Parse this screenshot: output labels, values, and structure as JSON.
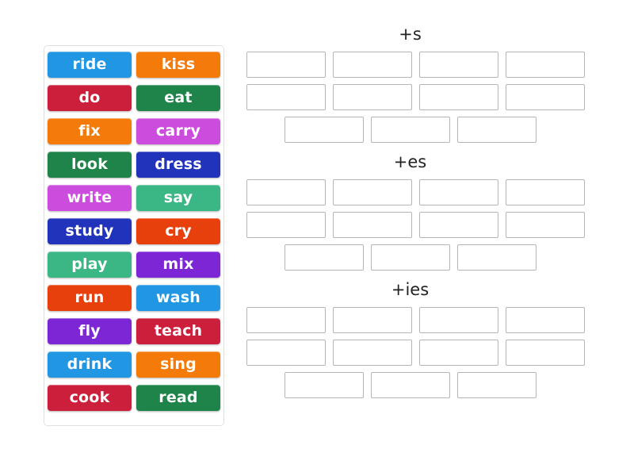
{
  "word_bank": {
    "name": "word-bank",
    "tiles": [
      {
        "label": "ride",
        "color": "#2196e3"
      },
      {
        "label": "kiss",
        "color": "#f47b0a"
      },
      {
        "label": "do",
        "color": "#cc1f3c"
      },
      {
        "label": "eat",
        "color": "#1e8449"
      },
      {
        "label": "fix",
        "color": "#f47b0a"
      },
      {
        "label": "carry",
        "color": "#c churn"
      },
      {
        "label": "look",
        "color": "#1e8449"
      },
      {
        "label": "dress",
        "color": "#2233bb"
      },
      {
        "label": "write",
        "color": "#cc4ddd"
      },
      {
        "label": "say",
        "color": "#3bb685"
      },
      {
        "label": "study",
        "color": "#2233bb"
      },
      {
        "label": "cry",
        "color": "#e8400c"
      },
      {
        "label": "play",
        "color": "#3bb685"
      },
      {
        "label": "mix",
        "color": "#7d26d6"
      },
      {
        "label": "run",
        "color": "#e8400c"
      },
      {
        "label": "wash",
        "color": "#2196e3"
      },
      {
        "label": "fly",
        "color": "#7d26d6"
      },
      {
        "label": "teach",
        "color": "#cc1f3c"
      },
      {
        "label": "drink",
        "color": "#2196e3"
      },
      {
        "label": "sing",
        "color": "#f47b0a"
      },
      {
        "label": "cook",
        "color": "#cc1f3c"
      },
      {
        "label": "read",
        "color": "#1e8449"
      }
    ]
  },
  "groups": [
    {
      "title": "+s",
      "rows": [
        {
          "slots": 4,
          "centered": false
        },
        {
          "slots": 4,
          "centered": false
        },
        {
          "slots": 3,
          "centered": true
        }
      ]
    },
    {
      "title": "+es",
      "rows": [
        {
          "slots": 4,
          "centered": false
        },
        {
          "slots": 4,
          "centered": false
        },
        {
          "slots": 3,
          "centered": true
        }
      ]
    },
    {
      "title": "+ies",
      "rows": [
        {
          "slots": 4,
          "centered": false
        },
        {
          "slots": 4,
          "centered": false
        },
        {
          "slots": 3,
          "centered": true
        }
      ]
    }
  ]
}
